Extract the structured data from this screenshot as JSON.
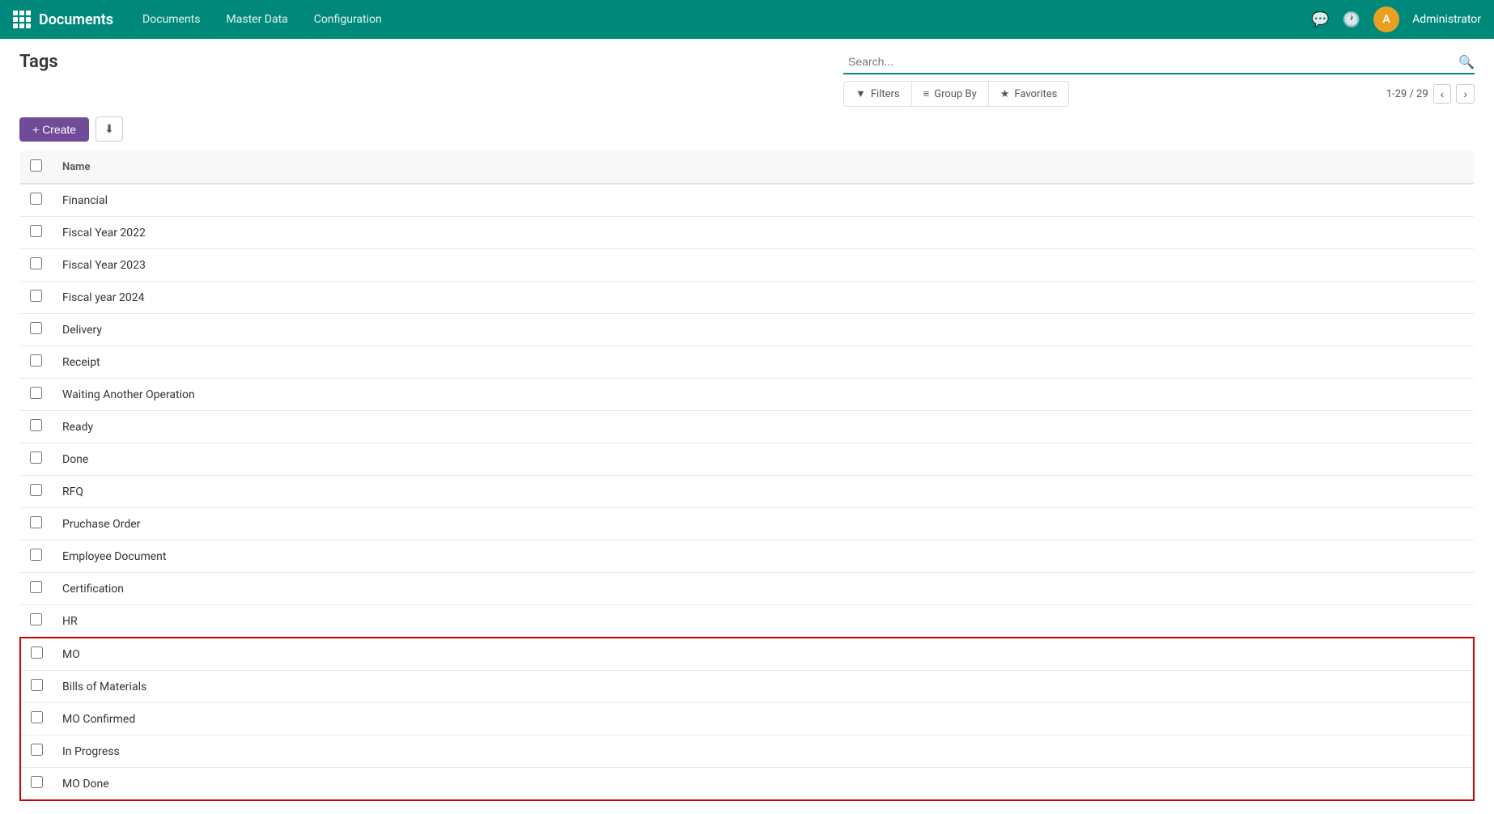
{
  "app": {
    "title": "Documents",
    "nav_items": [
      "Documents",
      "Master Data",
      "Configuration"
    ]
  },
  "user": {
    "name": "Administrator",
    "avatar_initial": "A"
  },
  "page": {
    "title": "Tags",
    "create_label": "+ Create",
    "download_icon": "⬇",
    "search_placeholder": "Search...",
    "filters_label": "Filters",
    "group_by_label": "Group By",
    "favorites_label": "Favorites",
    "pagination": "1-29 / 29",
    "column_name": "Name"
  },
  "rows": [
    {
      "id": 1,
      "name": "Financial",
      "highlighted": false
    },
    {
      "id": 2,
      "name": "Fiscal Year 2022",
      "highlighted": false
    },
    {
      "id": 3,
      "name": "Fiscal Year 2023",
      "highlighted": false
    },
    {
      "id": 4,
      "name": "Fiscal year 2024",
      "highlighted": false
    },
    {
      "id": 5,
      "name": "Delivery",
      "highlighted": false
    },
    {
      "id": 6,
      "name": "Receipt",
      "highlighted": false
    },
    {
      "id": 7,
      "name": "Waiting Another Operation",
      "highlighted": false
    },
    {
      "id": 8,
      "name": "Ready",
      "highlighted": false
    },
    {
      "id": 9,
      "name": "Done",
      "highlighted": false
    },
    {
      "id": 10,
      "name": "RFQ",
      "highlighted": false
    },
    {
      "id": 11,
      "name": "Pruchase Order",
      "highlighted": false
    },
    {
      "id": 12,
      "name": "Employee Document",
      "highlighted": false
    },
    {
      "id": 13,
      "name": "Certification",
      "highlighted": false
    },
    {
      "id": 14,
      "name": "HR",
      "highlighted": false
    },
    {
      "id": 15,
      "name": "MO",
      "highlighted": true,
      "box_start": true
    },
    {
      "id": 16,
      "name": "Bills of Materials",
      "highlighted": true
    },
    {
      "id": 17,
      "name": "MO Confirmed",
      "highlighted": true
    },
    {
      "id": 18,
      "name": "In Progress",
      "highlighted": true
    },
    {
      "id": 19,
      "name": "MO Done",
      "highlighted": true,
      "box_end": true,
      "partial": true
    }
  ]
}
